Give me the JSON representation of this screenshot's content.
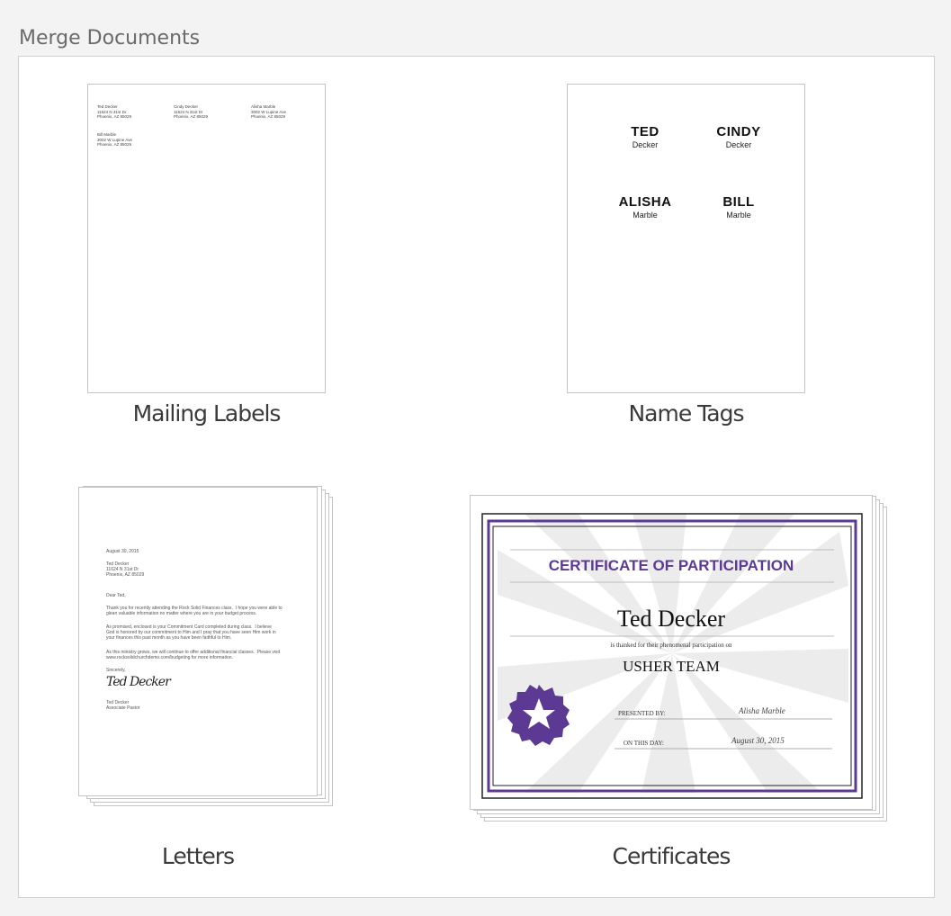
{
  "header": {
    "title": "Merge Documents"
  },
  "documents": {
    "mailing_labels": {
      "caption": "Mailing Labels",
      "labels": [
        {
          "name": "Ted Decker",
          "line1": "11624 N 31st Dr",
          "line2": "Phoenix, AZ 85029"
        },
        {
          "name": "Cindy Decker",
          "line1": "11624 N 31st Dr",
          "line2": "Phoenix, AZ 85029"
        },
        {
          "name": "Alisha Marble",
          "line1": "3002 W Lupine Ave",
          "line2": "Phoenix, AZ 85029"
        },
        {
          "name": "Bill Marble",
          "line1": "3002 W Lupine Ave",
          "line2": "Phoenix, AZ 85029"
        }
      ]
    },
    "name_tags": {
      "caption": "Name Tags",
      "tags": [
        {
          "first": "TED",
          "last": "Decker"
        },
        {
          "first": "CINDY",
          "last": "Decker"
        },
        {
          "first": "ALISHA",
          "last": "Marble"
        },
        {
          "first": "BILL",
          "last": "Marble"
        }
      ]
    },
    "letters": {
      "caption": "Letters",
      "date": "August 30, 2015",
      "address": [
        "Ted Decker",
        "11624 N 31st Dr",
        "Phoenix, AZ 85029"
      ],
      "greeting": "Dear Ted,",
      "p1": "Thank you for recently attending the Rock Solid Finances class.  I hope you were able to\nglean valuable information no matter where you are in your budget process.",
      "p2": "As promised, enclosed is your Commitment Card completed during class.  I believe\nGod is honored by our commitment to Him and I pray that you have seen Him work in\nyour finances this past month as you have been faithful to Him.",
      "p3": "As this ministry grows, we will continue to offer additional financial classes.  Please visit\nwww.rocksolidchurchdemo.com/budgeting for more information.",
      "closing": "Sincerely,",
      "signature": "Ted Decker",
      "signer": "Ted Decker",
      "signer_title": "Associate Pastor"
    },
    "certificates": {
      "caption": "Certificates",
      "heading": "CERTIFICATE OF PARTICIPATION",
      "recipient": "Ted Decker",
      "subtitle": "is thanked for their phenomenal participation on",
      "team": "USHER TEAM",
      "presented_label": "PRESENTED BY:",
      "presented_value": "Alisha Marble",
      "date_label": "ON THIS DAY:",
      "date_value": "August 30, 2015",
      "accent_color": "#5c3a93"
    }
  }
}
